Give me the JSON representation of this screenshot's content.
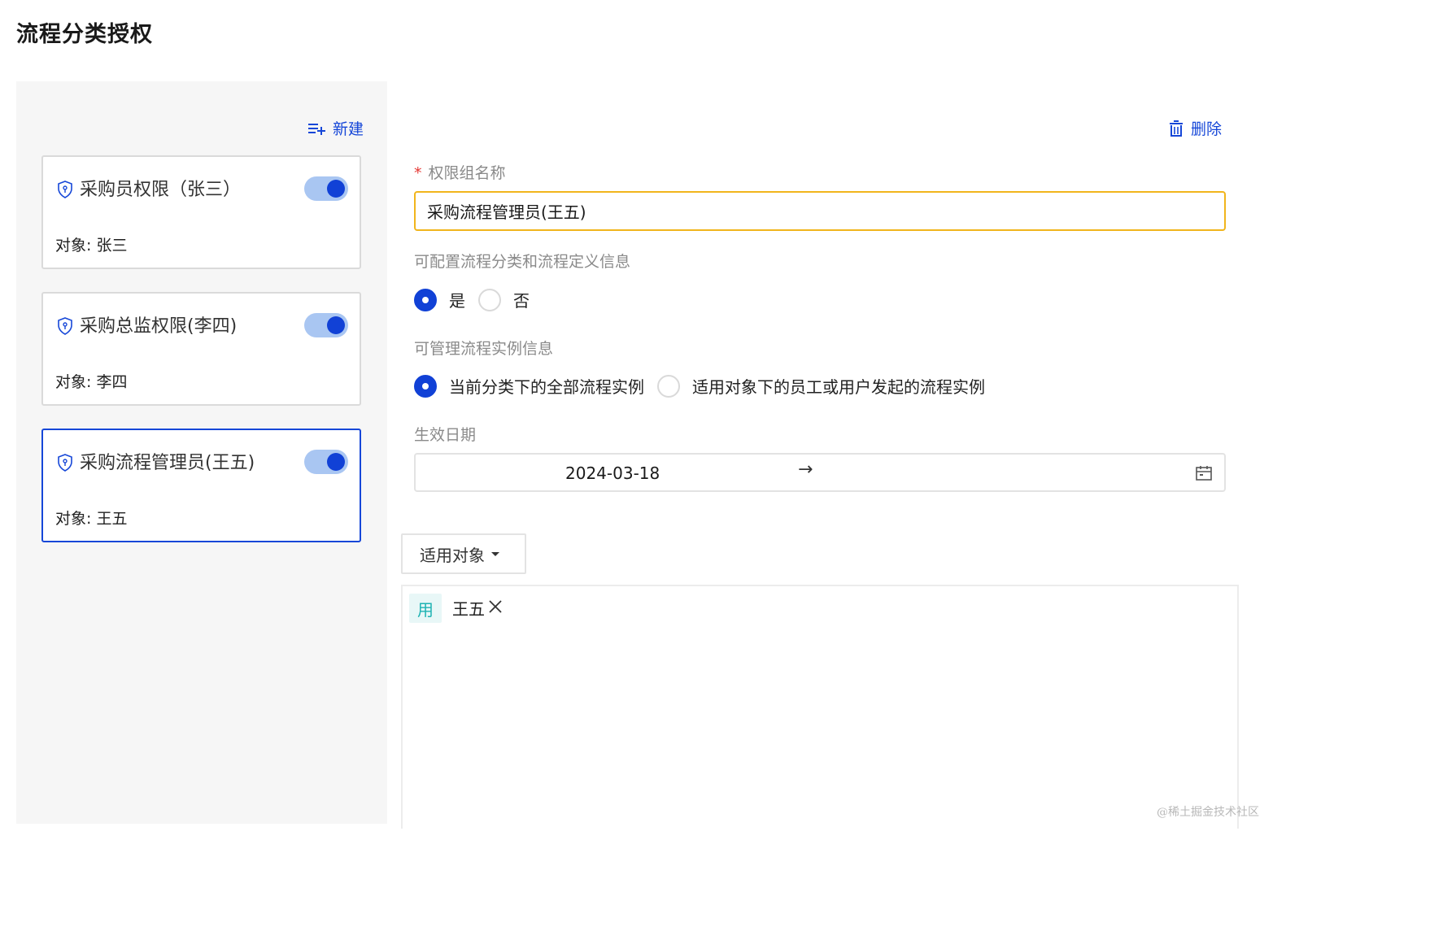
{
  "page": {
    "title": "流程分类授权"
  },
  "sidebar": {
    "new_label": "新建",
    "groups": [
      {
        "name": "采购员权限（张三）",
        "target": "对象: 张三",
        "enabled": true,
        "selected": false
      },
      {
        "name": "采购总监权限(李四)",
        "target": "对象: 李四",
        "enabled": true,
        "selected": false
      },
      {
        "name": "采购流程管理员(王五)",
        "target": "对象: 王五",
        "enabled": true,
        "selected": true
      }
    ]
  },
  "form": {
    "delete_label": "删除",
    "required_mark": "*",
    "name_label": "权限组名称",
    "name_value": "采购流程管理员(王五)",
    "config_label": "可配置流程分类和流程定义信息",
    "config_options": [
      "是",
      "否"
    ],
    "config_selected": "是",
    "manage_label": "可管理流程实例信息",
    "manage_options": [
      "当前分类下的全部流程实例",
      "适用对象下的员工或用户发起的流程实例"
    ],
    "manage_selected": "当前分类下的全部流程实例",
    "date_label": "生效日期",
    "date_start": "2024-03-18",
    "date_separator": "→",
    "date_end": "",
    "target_dropdown_label": "适用对象",
    "target_tags": [
      {
        "type": "用",
        "name": "王五"
      }
    ]
  },
  "watermark": "@稀土掘金技术社区",
  "colors": {
    "primary": "#1141d6",
    "link": "#1647d8",
    "focus_border": "#f1b51c",
    "toggle_track": "#a9c6f2",
    "tag_bg": "#e8f7f7",
    "tag_text": "#1fb3b3"
  }
}
